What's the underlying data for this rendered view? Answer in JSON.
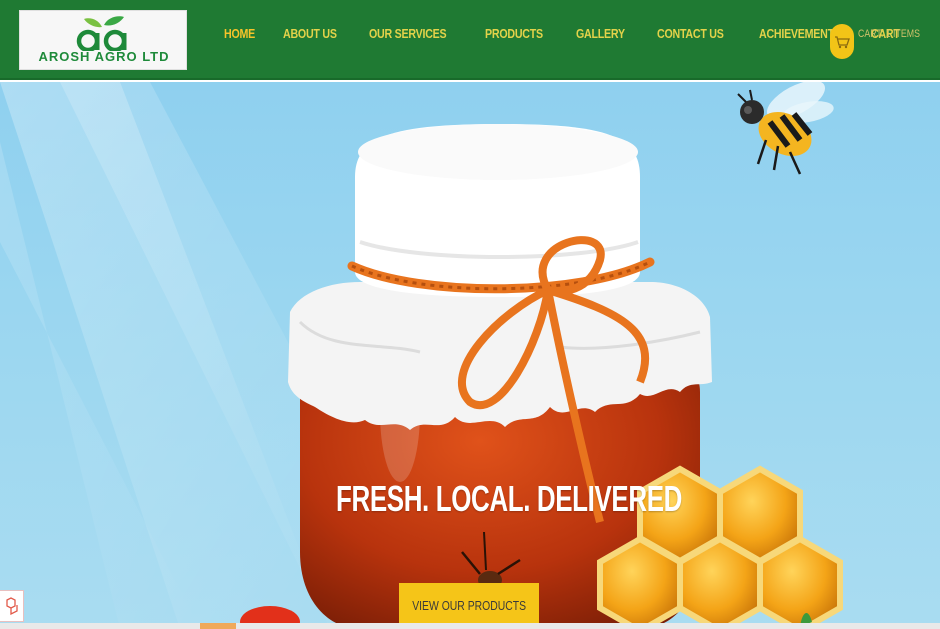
{
  "brand": {
    "name": "AROSH AGRO LTD",
    "logo_icon": "leaf-aa-logo",
    "colors": {
      "header": "#1f7a33",
      "nav_text": "#e3d24a",
      "accent": "#f5c518"
    }
  },
  "nav": {
    "items": [
      {
        "label": "HOME",
        "active": true
      },
      {
        "label": "ABOUT US"
      },
      {
        "label": "OUR SERVICES"
      },
      {
        "label": "PRODUCTS"
      },
      {
        "label": "GALLERY"
      },
      {
        "label": "CONTACT US"
      },
      {
        "label": "ACHIEVEMENT"
      },
      {
        "label": "CART"
      }
    ]
  },
  "cart": {
    "icon": "shopping-cart-icon",
    "text": "CART: 1 ITEMS"
  },
  "hero": {
    "headline": "FRESH. LOCAL. DELIVERED",
    "cta_label": "VIEW OUR PRODUCTS",
    "image": "honey-jar-bee-honeycomb-illustration"
  },
  "side_badge": {
    "icon": "laravel-icon"
  }
}
